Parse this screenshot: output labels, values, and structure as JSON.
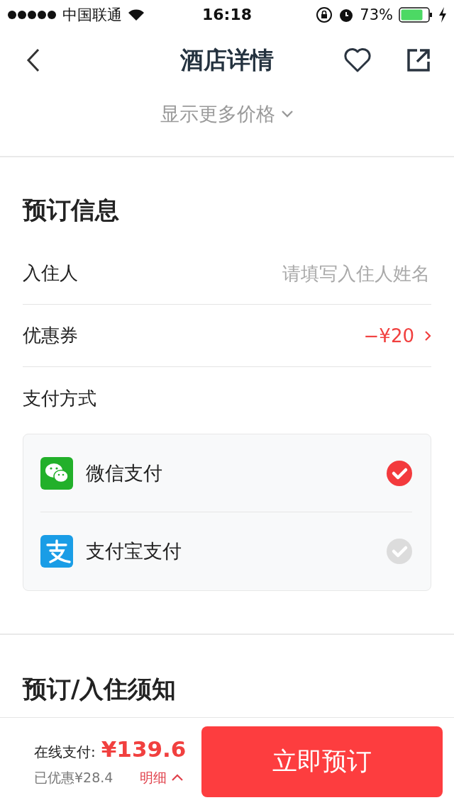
{
  "status_bar": {
    "carrier": "中国联通",
    "time": "16:18",
    "battery": "73%"
  },
  "nav": {
    "title": "酒店详情"
  },
  "more_prices": "显示更多价格",
  "booking": {
    "title": "预订信息",
    "guest": {
      "label": "入住人",
      "placeholder": "请填写入住人姓名"
    },
    "coupon": {
      "label": "优惠券",
      "value": "−¥20"
    },
    "payment_label": "支付方式",
    "payment_methods": [
      {
        "kind": "wechat",
        "name": "微信支付",
        "selected": true
      },
      {
        "kind": "alipay",
        "name": "支付宝支付",
        "selected": false
      }
    ]
  },
  "notice_title": "预订/入住须知",
  "footer": {
    "pay_label": "在线支付:",
    "price": "¥139.6",
    "discount": "已优惠¥28.4",
    "details": "明细",
    "book_button": "立即预订"
  }
}
